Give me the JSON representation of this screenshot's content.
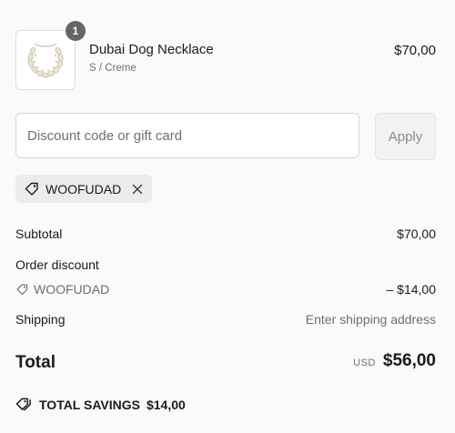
{
  "product": {
    "name": "Dubai Dog Necklace",
    "variant": "S / Creme",
    "price": "$70,00",
    "quantity": "1",
    "image_icon": "necklace-thumbnail"
  },
  "discount": {
    "placeholder": "Discount code or gift card",
    "value": "",
    "apply_label": "Apply",
    "applied_code": "WOOFUDAD",
    "tag_icon": "tag-icon",
    "remove_icon": "close-icon"
  },
  "summary": {
    "subtotal_label": "Subtotal",
    "subtotal_value": "$70,00",
    "order_discount_label": "Order discount",
    "order_discount_code": "WOOFUDAD",
    "order_discount_value": "– $14,00",
    "shipping_label": "Shipping",
    "shipping_value": "Enter shipping address",
    "total_label": "Total",
    "currency": "USD",
    "total_value": "$56,00",
    "savings_label": "TOTAL SAVINGS",
    "savings_value": "$14,00"
  },
  "colors": {
    "badge": "#666666",
    "muted_text": "#6e6e6e",
    "chip_bg": "#ececec",
    "page_bg": "#fafafa"
  }
}
